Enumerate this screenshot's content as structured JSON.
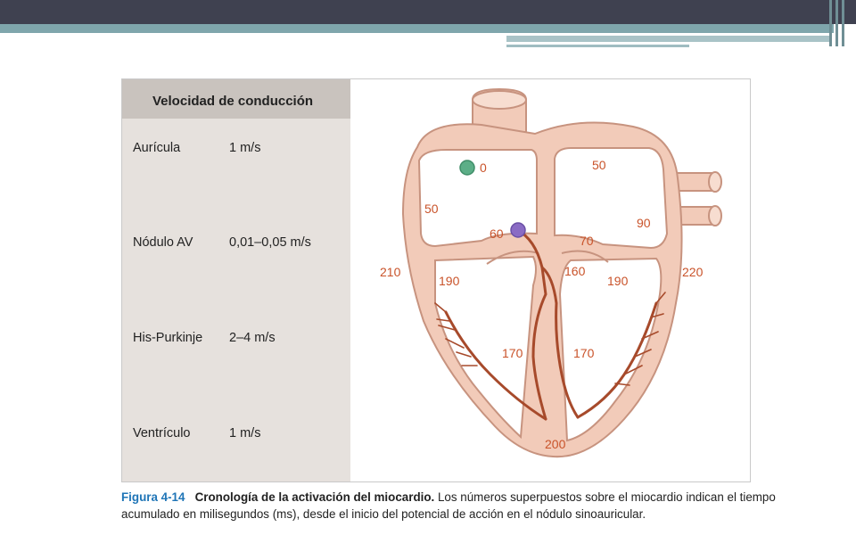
{
  "table": {
    "header": "Velocidad de conducción",
    "rows": [
      {
        "label": "Aurícula",
        "value": "1 m/s"
      },
      {
        "label": "Nódulo AV",
        "value": "0,01–0,05 m/s"
      },
      {
        "label": "His-Purkinje",
        "value": "2–4 m/s"
      },
      {
        "label": "Ventrículo",
        "value": "1 m/s"
      }
    ]
  },
  "diagram": {
    "times": [
      "0",
      "50",
      "50",
      "90",
      "60",
      "70",
      "210",
      "190",
      "160",
      "190",
      "220",
      "170",
      "170",
      "200"
    ]
  },
  "caption": {
    "number": "Figura 4-14",
    "title": "Cronología de la activación del miocardio.",
    "text": " Los números superpuestos sobre el miocardio indican el tiempo acumulado en milisegundos (ms), desde el inicio del potencial de acción en el nódulo sinoauricular."
  },
  "colors": {
    "heart_wall": "#f2cbb9",
    "heart_outline": "#c7937f",
    "conduction": "#a74a2b",
    "sa_node": "#5cae87",
    "av_node": "#8a6bc4",
    "time_label": "#c9532a",
    "caption_accent": "#1f75b7"
  }
}
